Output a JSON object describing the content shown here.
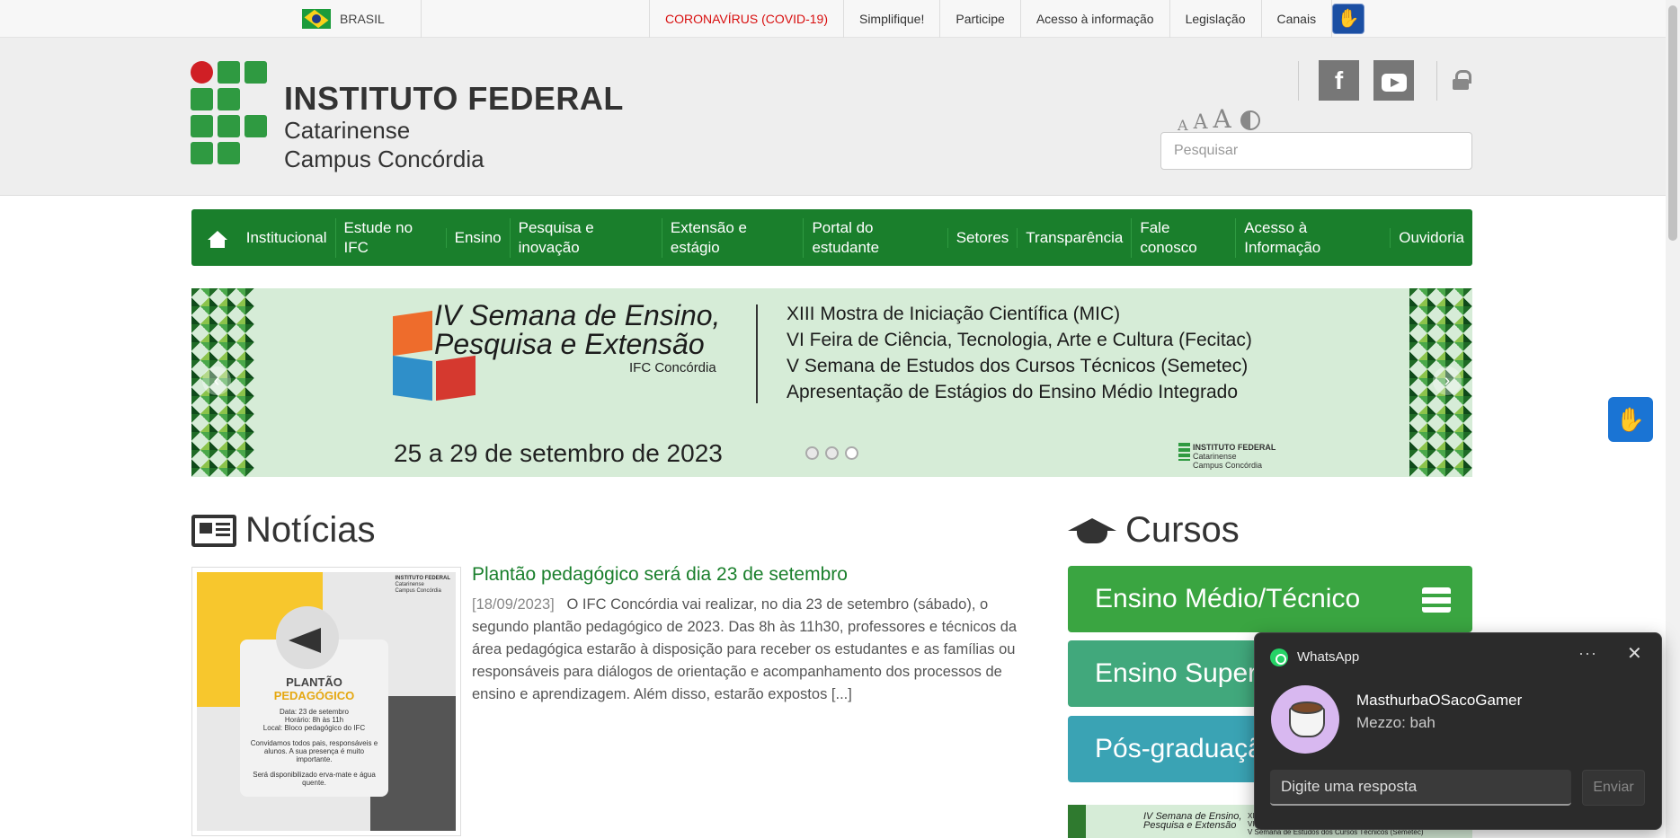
{
  "govbar": {
    "country": "BRASIL",
    "links": [
      "CORONAVÍRUS (COVID-19)",
      "Simplifique!",
      "Participe",
      "Acesso à informação",
      "Legislação",
      "Canais"
    ]
  },
  "header": {
    "brand_line1": "INSTITUTO FEDERAL",
    "brand_line2": "Catarinense",
    "brand_line3": "Campus Concórdia",
    "font_small": "A",
    "font_medium": "A",
    "font_large": "A",
    "facebook": "f",
    "search_placeholder": "Pesquisar"
  },
  "nav": {
    "items": [
      "Institucional",
      "Estude no IFC",
      "Ensino",
      "Pesquisa e inovação",
      "Extensão e estágio",
      "Portal do estudante",
      "Setores",
      "Transparência",
      "Fale conosco",
      "Acesso à Informação",
      "Ouvidoria"
    ]
  },
  "banner": {
    "title_line1": "IV Semana de Ensino,",
    "title_line2": "Pesquisa e Extensão",
    "subtitle": "IFC Concórdia",
    "lines": [
      "XIII Mostra de Iniciação Científica (MIC)",
      "VI Feira de Ciência, Tecnologia, Arte e Cultura (Fecitac)",
      "V Semana de Estudos dos Cursos Técnicos (Semetec)",
      "Apresentação de Estágios do Ensino Médio Integrado"
    ],
    "date": "25 a 29 de setembro de 2023",
    "logo_line1": "INSTITUTO FEDERAL",
    "logo_line2": "Catarinense",
    "logo_line3": "Campus Concórdia"
  },
  "news": {
    "section_title": "Notícias",
    "item": {
      "title": "Plantão pedagógico será dia 23 de setembro",
      "date": "[18/09/2023]",
      "excerpt": "O IFC Concórdia vai realizar, no dia 23 de setembro (sábado), o segundo plantão pedagógico de 2023. Das 8h às 11h30, professores e técnicos da área pedagógica estarão à disposição para receber os estudantes e as famílias ou responsáveis para diálogos de orientação e acompanhamento dos processos de ensino e aprendizagem. Além disso, estarão expostos [...]",
      "thumb_title1": "PLANTÃO",
      "thumb_title2": "PEDAGÓGICO",
      "thumb_l1": "Data: 23 de setembro",
      "thumb_l2": "Horário: 8h às 11h",
      "thumb_l3": "Local: Bloco pedagógico do IFC",
      "thumb_l4": "Convidamos todos pais, responsáveis e alunos. A sua presença é muito importante.",
      "thumb_l5": "Será disponibilizado erva-mate e água quente."
    }
  },
  "courses": {
    "section_title": "Cursos",
    "items": [
      "Ensino Médio/Técnico",
      "Ensino Superi",
      "Pós-graduaçã"
    ]
  },
  "toast": {
    "app": "WhatsApp",
    "more": "···",
    "close": "✕",
    "sender": "MasthurbaOSacoGamer",
    "message": "Mezzo: bah",
    "reply_placeholder": "Digite uma resposta",
    "send": "Enviar"
  },
  "colors": {
    "nav_green": "#1a7f2c",
    "covid_red": "#d80e0e",
    "course1": "#3aa541",
    "course2": "#41a87c",
    "course3": "#3aa3b4"
  }
}
